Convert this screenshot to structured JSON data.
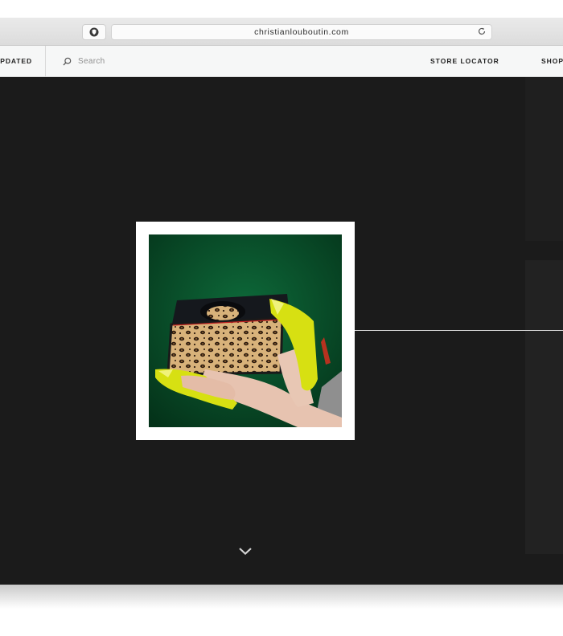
{
  "browser": {
    "url": "christianlouboutin.com",
    "shield_icon": "shield-icon",
    "reload_icon": "reload-icon"
  },
  "nav": {
    "updated_label": "UPDATED",
    "search_placeholder": "Search",
    "store_locator_label": "STORE LOCATOR",
    "shop_label": "SHOPP"
  },
  "main": {
    "scroll_icon": "chevron-down-icon",
    "photo_description_icon": "product-photo"
  },
  "colors": {
    "stage_bg": "#1b1b1b",
    "photo_bg": "#0b4a2a",
    "shoe_yellow": "#d7e012"
  }
}
